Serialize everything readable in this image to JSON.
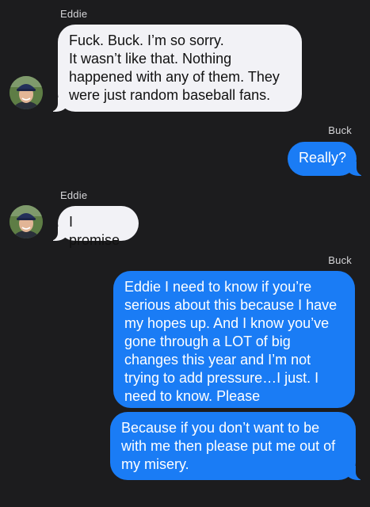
{
  "messages": [
    {
      "sender": "Eddie",
      "text": "Fuck. Buck. I’m so sorry.\nIt wasn’t like that. Nothing happened with any of them. They were just random baseball fans."
    },
    {
      "sender": "Buck",
      "text": "Really?"
    },
    {
      "sender": "Eddie",
      "text": "I promise"
    },
    {
      "sender": "Buck",
      "text": "Eddie I need to know if you’re serious about this because I have my hopes up. And I know you’ve gone through a LOT of big changes this year and I’m not trying to add pressure…I just. I need to know. Please"
    },
    {
      "sender": "",
      "text": "Because if you don’t want to be with me then please put me out of my misery."
    }
  ],
  "avatar": {
    "icon": "person-with-cap-avatar"
  },
  "colors": {
    "background": "#1c1c1e",
    "incoming_bubble": "#f2f2f6",
    "outgoing_bubble": "#1a7cf5"
  }
}
